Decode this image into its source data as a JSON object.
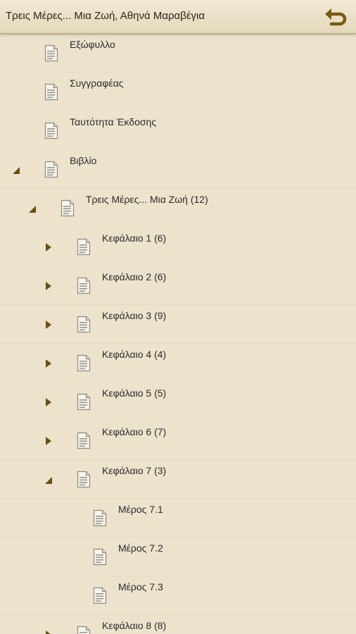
{
  "header": {
    "title": "Τρεις Μέρες... Μια Ζωή, Αθηνά Μαραβέγια",
    "back_icon": "undo-arrow-icon",
    "accent": "#7a5a12"
  },
  "toc": {
    "items": [
      {
        "label": "Εξώφυλλο",
        "level": 0,
        "expander": "none"
      },
      {
        "label": "Συγγραφέας",
        "level": 0,
        "expander": "none"
      },
      {
        "label": "Ταυτότητα Έκδοσης",
        "level": 0,
        "expander": "none"
      },
      {
        "label": "Βιβλίο",
        "level": 0,
        "expander": "expanded"
      },
      {
        "label": "Τρεις Μέρες... Μια Ζωή (12)",
        "level": 1,
        "expander": "expanded"
      },
      {
        "label": "Κεφάλαιο 1 (6)",
        "level": 2,
        "expander": "collapsed"
      },
      {
        "label": "Κεφάλαιο 2 (6)",
        "level": 2,
        "expander": "collapsed"
      },
      {
        "label": "Κεφάλαιο 3 (9)",
        "level": 2,
        "expander": "collapsed"
      },
      {
        "label": "Κεφάλαιο 4 (4)",
        "level": 2,
        "expander": "collapsed"
      },
      {
        "label": "Κεφάλαιο 5 (5)",
        "level": 2,
        "expander": "collapsed"
      },
      {
        "label": "Κεφάλαιο 6 (7)",
        "level": 2,
        "expander": "collapsed"
      },
      {
        "label": "Κεφάλαιο 7 (3)",
        "level": 2,
        "expander": "expanded"
      },
      {
        "label": "Μέρος 7.1",
        "level": 3,
        "expander": "none"
      },
      {
        "label": "Μέρος 7.2",
        "level": 3,
        "expander": "none"
      },
      {
        "label": "Μέρος 7.3",
        "level": 3,
        "expander": "none"
      },
      {
        "label": "Κεφάλαιο 8 (8)",
        "level": 2,
        "expander": "collapsed"
      }
    ],
    "icon": "document-icon",
    "expander_color": "#6b4f12"
  }
}
